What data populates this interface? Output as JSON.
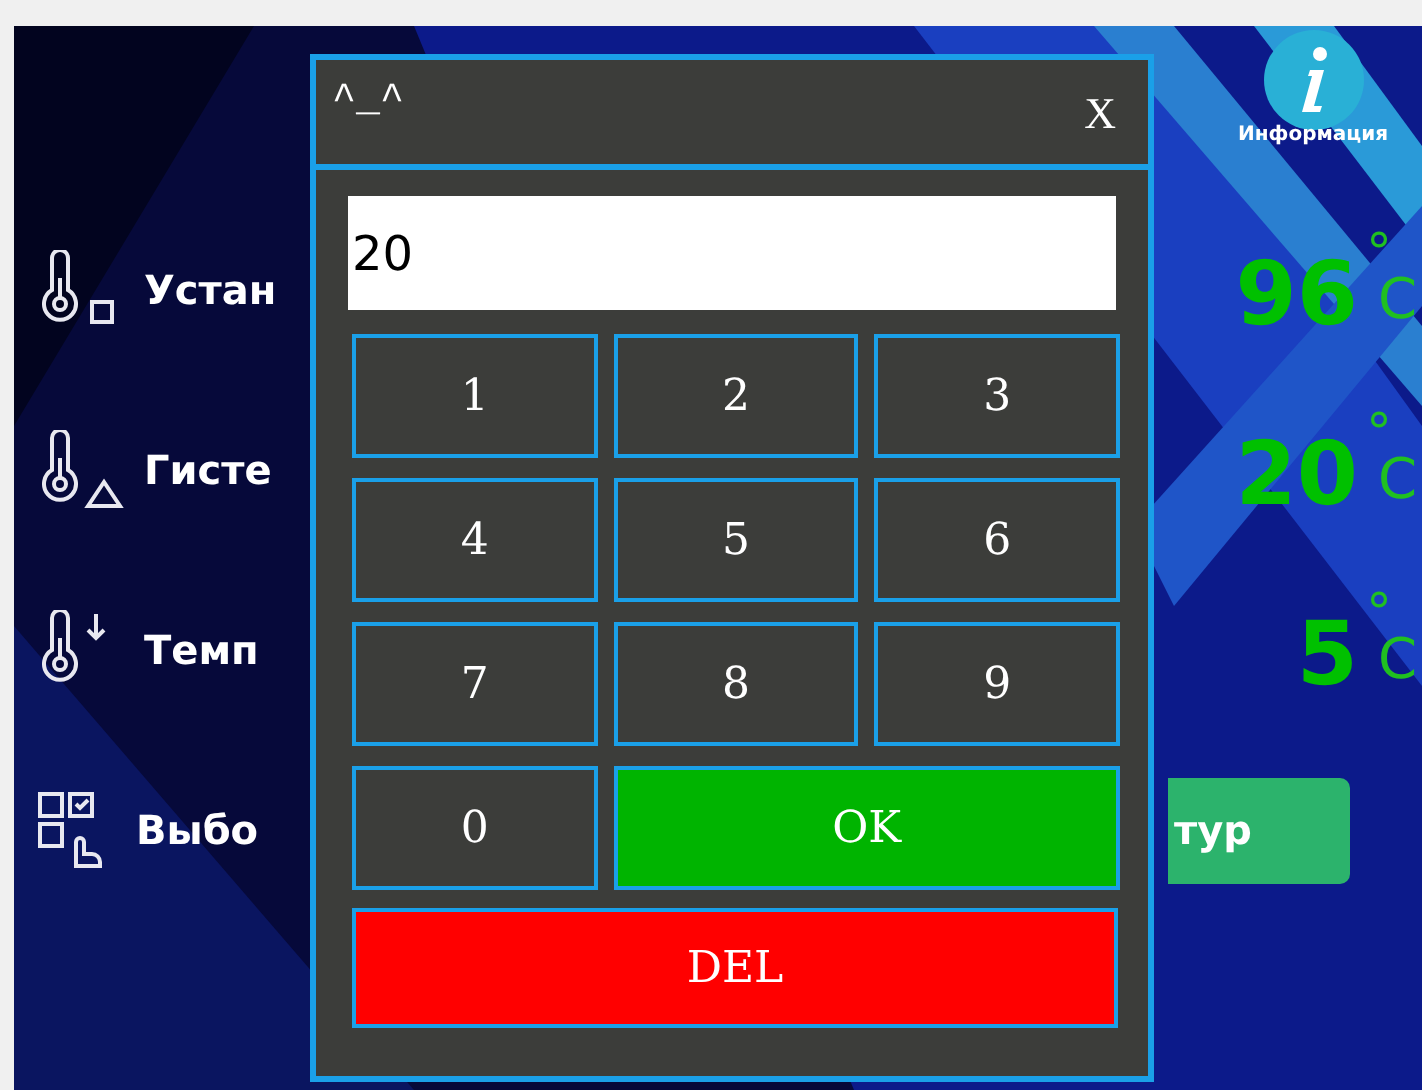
{
  "screen": {
    "info": {
      "label": "Информация"
    },
    "rows": [
      {
        "kind": "setpoint",
        "label": "Устан",
        "value": "96",
        "degree": "°",
        "unit": "C"
      },
      {
        "kind": "hysteresis",
        "label": "Гисте",
        "value": "20",
        "degree": "°",
        "unit": "C"
      },
      {
        "kind": "drop",
        "label": "Темп",
        "value": "5",
        "degree": "°",
        "unit": "C"
      },
      {
        "kind": "select",
        "label": "Выбо",
        "button": "тур"
      }
    ]
  },
  "dialog": {
    "title": "^_^",
    "close": "X",
    "input": {
      "value": "20"
    },
    "keys": [
      {
        "kind": "digit",
        "label": "1"
      },
      {
        "kind": "digit",
        "label": "2"
      },
      {
        "kind": "digit",
        "label": "3"
      },
      {
        "kind": "digit",
        "label": "4"
      },
      {
        "kind": "digit",
        "label": "5"
      },
      {
        "kind": "digit",
        "label": "6"
      },
      {
        "kind": "digit",
        "label": "7"
      },
      {
        "kind": "digit",
        "label": "8"
      },
      {
        "kind": "digit",
        "label": "9"
      },
      {
        "kind": "digit",
        "label": "0"
      },
      {
        "kind": "ok",
        "label": "OK"
      }
    ],
    "delete": "DEL"
  }
}
